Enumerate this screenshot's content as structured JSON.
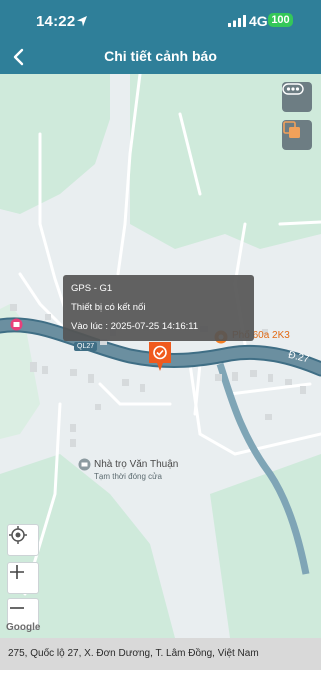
{
  "status_bar": {
    "time": "14:22",
    "network": "4G",
    "battery": "100"
  },
  "header": {
    "title": "Chi tiết cảnh báo"
  },
  "popup": {
    "device": "GPS - G1",
    "event": "Thiết bị có kết nối",
    "time_text": "Vào lúc : 2025-07-25 14:16:11"
  },
  "map": {
    "labels": {
      "ql27": "QL27",
      "d27": "Đ.27",
      "shop": "Phố 60a 2K3",
      "lodging_name": "Nhà trọ Văn Thuận",
      "lodging_status": "Tạm thời đóng cửa",
      "google": "Google"
    }
  },
  "address": "275, Quốc lộ 27, X. Đơn Dương, T. Lâm Đồng, Việt Nam",
  "colors": {
    "header": "#2f7f99",
    "road": "#6b8fa0",
    "land": "#e9eef0",
    "park": "#c9e9d6",
    "marker": "#f05a1e"
  }
}
